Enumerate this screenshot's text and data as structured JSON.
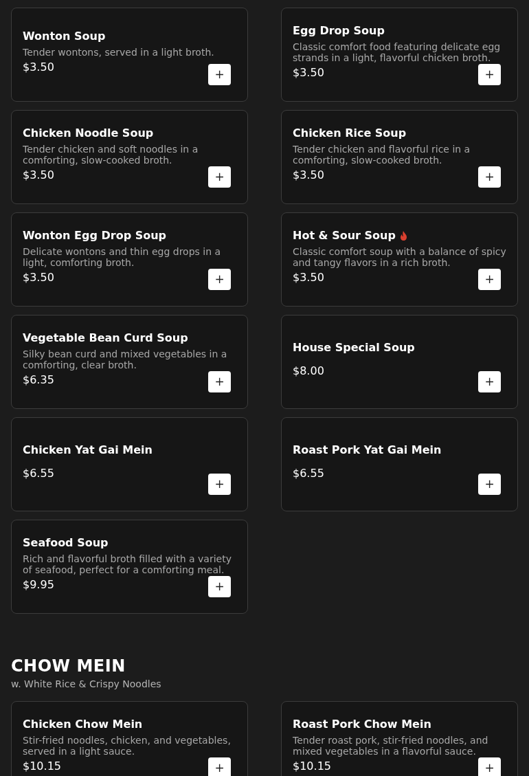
{
  "sections": [
    {
      "items": [
        {
          "name": "Wonton Soup",
          "description": "Tender wontons, served in a light broth.",
          "price": "$3.50",
          "spicy": false
        },
        {
          "name": "Egg Drop Soup",
          "description": "Classic comfort food featuring delicate egg strands in a light, flavorful chicken broth.",
          "price": "$3.50",
          "spicy": false
        },
        {
          "name": "Chicken Noodle Soup",
          "description": "Tender chicken and soft noodles in a comforting, slow-cooked broth.",
          "price": "$3.50",
          "spicy": false
        },
        {
          "name": "Chicken Rice Soup",
          "description": "Tender chicken and flavorful rice in a comforting, slow-cooked broth.",
          "price": "$3.50",
          "spicy": false
        },
        {
          "name": "Wonton Egg Drop Soup",
          "description": "Delicate wontons and thin egg drops in a light, comforting broth.",
          "price": "$3.50",
          "spicy": false
        },
        {
          "name": "Hot & Sour Soup",
          "description": "Classic comfort soup with a balance of spicy and tangy flavors in a rich broth.",
          "price": "$3.50",
          "spicy": true
        },
        {
          "name": "Vegetable Bean Curd Soup",
          "description": "Silky bean curd and mixed vegetables in a comforting, clear broth.",
          "price": "$6.35",
          "spicy": false
        },
        {
          "name": "House Special Soup",
          "price": "$8.00",
          "spicy": false
        },
        {
          "name": "Chicken Yat Gai Mein",
          "price": "$6.55",
          "spicy": false
        },
        {
          "name": "Roast Pork Yat Gai Mein",
          "price": "$6.55",
          "spicy": false
        },
        {
          "name": "Seafood Soup",
          "description": "Rich and flavorful broth filled with a variety of seafood, perfect for a comforting meal.",
          "price": "$9.95",
          "spicy": false
        }
      ]
    },
    {
      "title": "CHOW MEIN",
      "subtitle": "w. White Rice & Crispy Noodles",
      "items": [
        {
          "name": "Chicken Chow Mein",
          "description": "Stir-fried noodles, chicken, and vegetables, served in a light sauce.",
          "price": "$10.15",
          "spicy": false
        },
        {
          "name": "Roast Pork Chow Mein",
          "description": "Tender roast pork, stir-fried noodles, and mixed vegetables in a flavorful sauce.",
          "price": "$10.15",
          "spicy": false
        }
      ]
    }
  ],
  "add_button": "+"
}
